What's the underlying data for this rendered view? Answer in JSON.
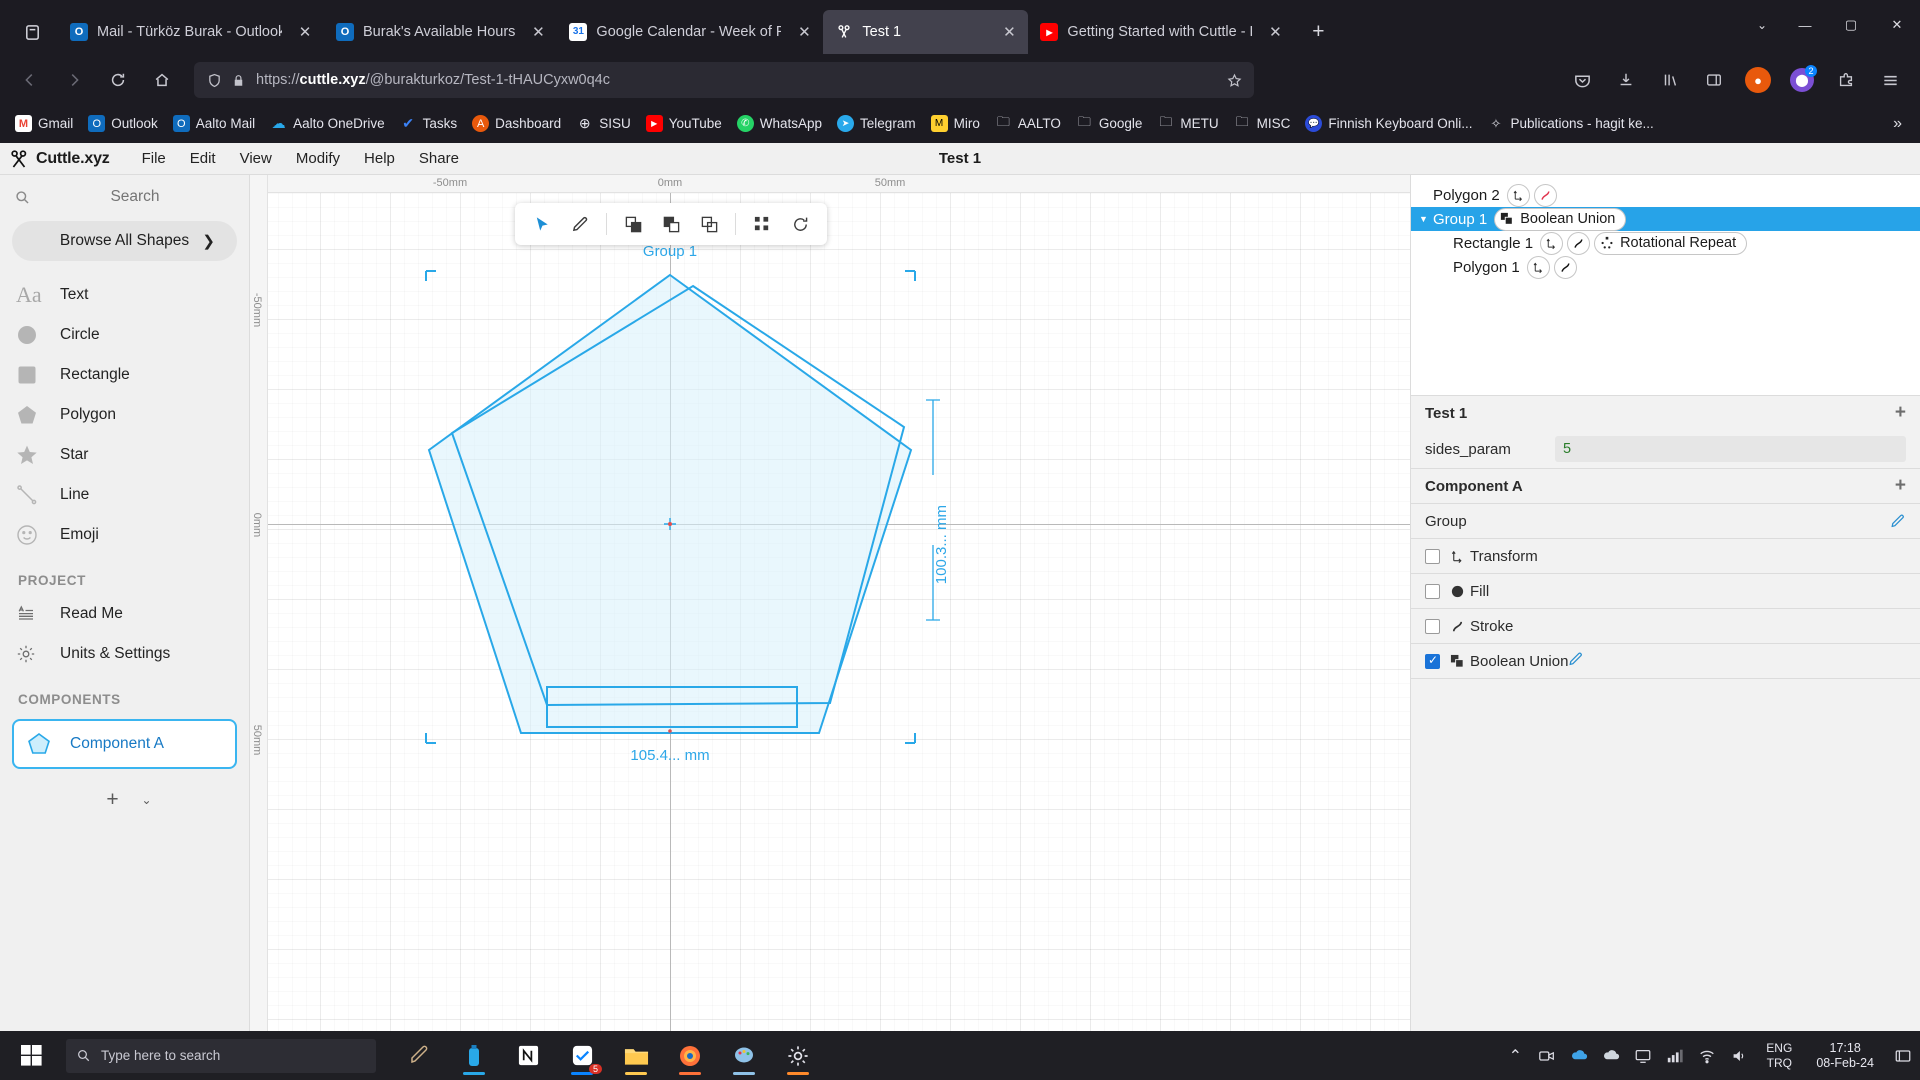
{
  "browser": {
    "tabs": [
      {
        "title": "Mail - Türköz Burak - Outlook",
        "favicon": "outlook-icon",
        "active": false
      },
      {
        "title": "Burak's Available Hours",
        "favicon": "outlook-icon",
        "active": false
      },
      {
        "title": "Google Calendar - Week of Feb",
        "favicon": "google-calendar-icon",
        "active": false
      },
      {
        "title": "Test 1",
        "favicon": "cuttle-icon",
        "active": true
      },
      {
        "title": "Getting Started with Cuttle - Pa",
        "favicon": "youtube-icon",
        "active": false
      }
    ],
    "new_tab_label": "+",
    "window_controls": {
      "list_all_tabs": "v",
      "minimize": "—",
      "maximize": "▢",
      "close": "✕"
    },
    "url": {
      "scheme": "https://",
      "domain": "cuttle.xyz",
      "path": "/@burakturkoz/Test-1-tHAUCyxw0q4c"
    },
    "nav": {
      "back": "←",
      "forward": "→",
      "reload": "⟳",
      "home": "⌂",
      "bookmark_star": "☆"
    },
    "extension_badge": "2",
    "bookmarks": [
      {
        "label": "Gmail",
        "icon": "gmail-icon"
      },
      {
        "label": "Outlook",
        "icon": "outlook-icon"
      },
      {
        "label": "Aalto Mail",
        "icon": "outlook-icon"
      },
      {
        "label": "Aalto OneDrive",
        "icon": "onedrive-icon"
      },
      {
        "label": "Tasks",
        "icon": "tasks-check-icon"
      },
      {
        "label": "Dashboard",
        "icon": "dashboard-icon"
      },
      {
        "label": "SISU",
        "icon": "sisu-globe-icon"
      },
      {
        "label": "YouTube",
        "icon": "youtube-icon"
      },
      {
        "label": "WhatsApp",
        "icon": "whatsapp-icon"
      },
      {
        "label": "Telegram",
        "icon": "telegram-icon"
      },
      {
        "label": "Miro",
        "icon": "miro-icon"
      },
      {
        "label": "AALTO",
        "icon": "folder-icon"
      },
      {
        "label": "Google",
        "icon": "folder-icon"
      },
      {
        "label": "METU",
        "icon": "folder-icon"
      },
      {
        "label": "MISC",
        "icon": "folder-icon"
      },
      {
        "label": "Finnish Keyboard Onli...",
        "icon": "chat-icon"
      },
      {
        "label": "Publications - hagit ke...",
        "icon": "spark-icon"
      }
    ],
    "bookmarks_overflow": "»"
  },
  "app": {
    "brand": "Cuttle.xyz",
    "menu": [
      "File",
      "Edit",
      "View",
      "Modify",
      "Help",
      "Share"
    ],
    "document_title": "Test 1",
    "sidebar": {
      "search_placeholder": "Search",
      "browse_all": "Browse All Shapes",
      "shapes": [
        {
          "label": "Text",
          "icon": "text-icon"
        },
        {
          "label": "Circle",
          "icon": "circle-icon"
        },
        {
          "label": "Rectangle",
          "icon": "rectangle-icon"
        },
        {
          "label": "Polygon",
          "icon": "polygon-icon"
        },
        {
          "label": "Star",
          "icon": "star-icon"
        },
        {
          "label": "Line",
          "icon": "line-icon"
        },
        {
          "label": "Emoji",
          "icon": "emoji-icon"
        }
      ],
      "project_heading": "PROJECT",
      "project_items": [
        {
          "label": "Read Me",
          "icon": "readme-icon"
        },
        {
          "label": "Units & Settings",
          "icon": "gear-icon"
        }
      ],
      "components_heading": "COMPONENTS",
      "components": [
        {
          "label": "Component A",
          "icon": "component-pentagon-icon"
        }
      ],
      "add_button": "+",
      "add_caret": "⌄"
    },
    "canvas": {
      "ruler_top_ticks": [
        "-50mm",
        "0mm",
        "50mm"
      ],
      "ruler_left_ticks": [
        "-50mm",
        "0mm",
        "50mm"
      ],
      "group_label": "Group 1",
      "dimension_width": "105.4... mm",
      "dimension_height": "100.3... mm",
      "accent_color": "#29a8e8",
      "toolbar": [
        {
          "icon": "select-arrow-icon",
          "active": true
        },
        {
          "icon": "pen-icon",
          "active": false
        },
        {
          "icon": "boolean-union-icon",
          "active": false
        },
        {
          "icon": "boolean-subtract-icon",
          "active": false
        },
        {
          "icon": "boolean-intersect-icon",
          "active": false
        },
        {
          "icon": "grid-repeat-icon",
          "active": false
        },
        {
          "icon": "rotational-repeat-icon",
          "active": false
        }
      ]
    },
    "tree": [
      {
        "name": "Polygon 2",
        "level": 1,
        "selected": false,
        "badges": [
          "transform-icon",
          "stroke-icon"
        ],
        "pill": null
      },
      {
        "name": "Group 1",
        "level": 1,
        "selected": true,
        "badges": [],
        "pill": {
          "label": "Boolean Union",
          "icon": "boolean-union-icon"
        },
        "caret": "▼"
      },
      {
        "name": "Rectangle 1",
        "level": 2,
        "selected": false,
        "badges": [
          "transform-icon",
          "stroke-icon"
        ],
        "pill": {
          "label": "Rotational Repeat",
          "icon": "rotational-repeat-icon"
        }
      },
      {
        "name": "Polygon 1",
        "level": 2,
        "selected": false,
        "badges": [
          "transform-icon",
          "stroke-icon"
        ],
        "pill": null
      }
    ],
    "properties": {
      "doc_section": {
        "title": "Test 1",
        "add": "+"
      },
      "params": [
        {
          "name": "sides_param",
          "value": "5"
        }
      ],
      "component_section": {
        "title": "Component A",
        "add": "+"
      },
      "group_row": {
        "label": "Group",
        "edit": "pencil-icon"
      },
      "modifiers": [
        {
          "label": "Transform",
          "checked": false,
          "icon": "transform-icon"
        },
        {
          "label": "Fill",
          "checked": false,
          "icon": "fill-icon"
        },
        {
          "label": "Stroke",
          "checked": false,
          "icon": "stroke-icon"
        },
        {
          "label": "Boolean Union",
          "checked": true,
          "icon": "boolean-union-icon",
          "edit": "pencil-icon"
        }
      ]
    }
  },
  "taskbar": {
    "start": "windows-icon",
    "search_placeholder": "Type here to search",
    "apps": [
      {
        "icon": "snip-sketch-icon",
        "running": false
      },
      {
        "icon": "water-bottle-icon",
        "running": true
      },
      {
        "icon": "notion-icon",
        "running": false
      },
      {
        "icon": "todoist-icon",
        "running": true,
        "badge": "5"
      },
      {
        "icon": "file-explorer-icon",
        "running": true
      },
      {
        "icon": "firefox-icon",
        "running": true
      },
      {
        "icon": "paint-icon",
        "running": true
      },
      {
        "icon": "settings-gear-icon",
        "running": true
      }
    ],
    "tray": [
      "chevron-up-icon",
      "meet-now-icon",
      "onedrive-icon",
      "cloud-icon",
      "monitor-icon",
      "network-icon",
      "wifi-icon",
      "volume-icon"
    ],
    "language_line1": "ENG",
    "language_line2": "TRQ",
    "clock_time": "17:18",
    "clock_date": "08-Feb-24",
    "notification_icon": "notification-icon"
  }
}
